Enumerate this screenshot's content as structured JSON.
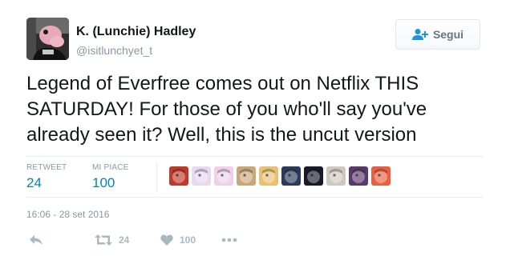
{
  "user": {
    "name": "K. (Lunchie) Hadley",
    "handle": "@isitlunchyet_t",
    "avatar_icon": "avatar-photo"
  },
  "follow_button": {
    "label": "Segui",
    "icon": "add-user-icon",
    "color": "#1b95e0"
  },
  "tweet": {
    "text": "Legend of Everfree comes out on Netflix THIS SATURDAY! For those of you who'll say you've already seen it? Well, this is the uncut version"
  },
  "stats": {
    "retweet_label": "RETWEET",
    "retweet_count": "24",
    "like_label": "MI PIACE",
    "like_count": "100"
  },
  "likers": [
    {
      "icon": "liker-avatar-1",
      "bg": "#c0392b"
    },
    {
      "icon": "liker-avatar-2",
      "bg": "#e8d8f0"
    },
    {
      "icon": "liker-avatar-3",
      "bg": "#f0d0e8"
    },
    {
      "icon": "liker-avatar-4",
      "bg": "#c8a878"
    },
    {
      "icon": "liker-avatar-5",
      "bg": "#e8c070"
    },
    {
      "icon": "liker-avatar-6",
      "bg": "#2a3a5a"
    },
    {
      "icon": "liker-avatar-7",
      "bg": "#1a1a2a"
    },
    {
      "icon": "liker-avatar-8",
      "bg": "#d0c8c0"
    },
    {
      "icon": "liker-avatar-9",
      "bg": "#5a3a6a"
    },
    {
      "icon": "liker-avatar-10",
      "bg": "#e86040"
    }
  ],
  "timestamp": "16:06 - 28 set 2016",
  "actions": {
    "retweet_count": "24",
    "like_count": "100"
  },
  "colors": {
    "link_blue": "#0084b4",
    "muted_gray": "#8899a6",
    "icon_gray": "#aab8c2"
  }
}
